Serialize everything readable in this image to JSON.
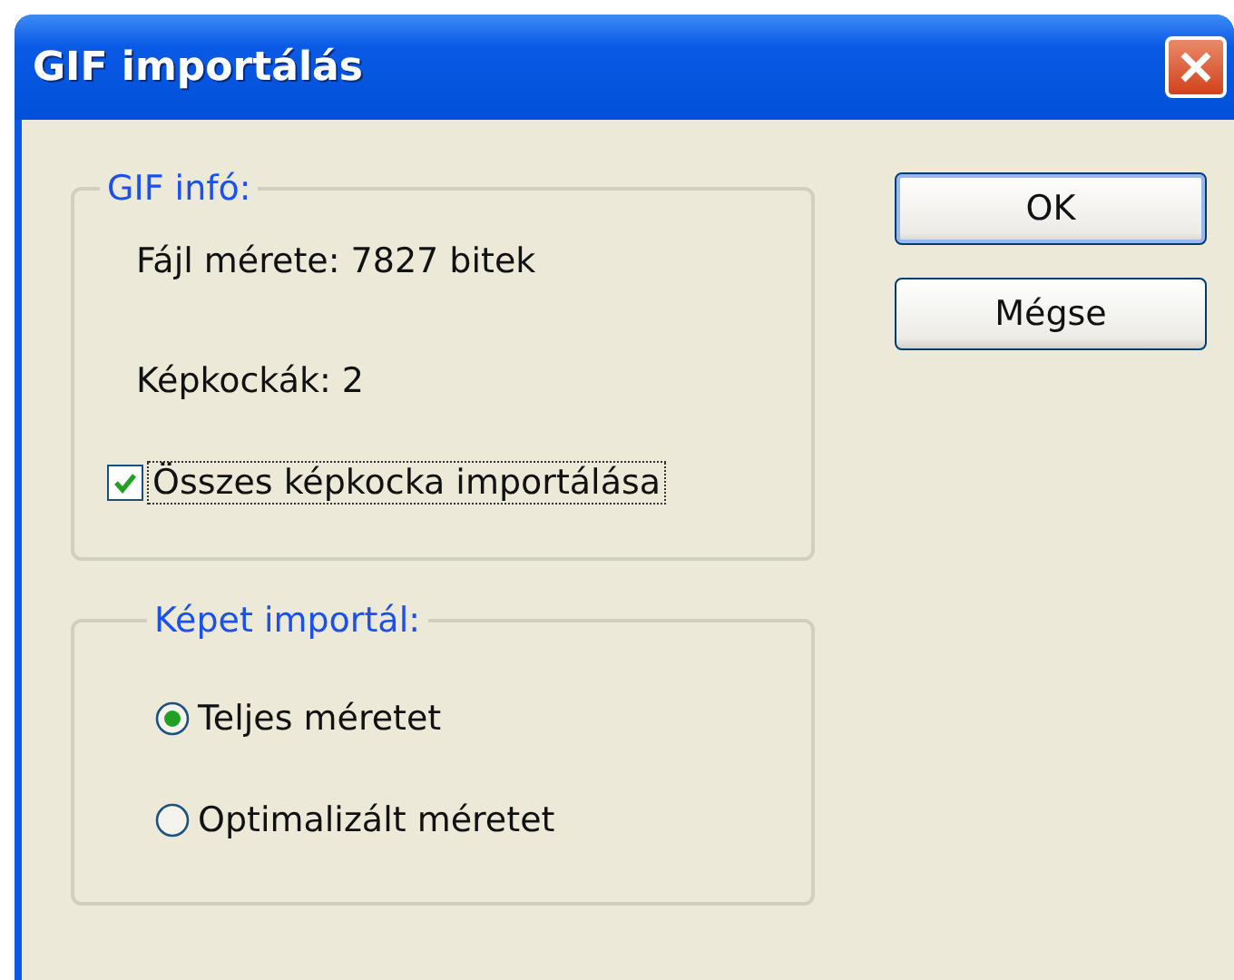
{
  "window": {
    "title": "GIF importálás"
  },
  "gif_info": {
    "title": "GIF infó:",
    "file_size": "Fájl mérete: 7827 bitek",
    "frames": "Képkockák: 2",
    "import_all": {
      "label": "Összes képkocka importálása",
      "checked": true
    }
  },
  "import_image": {
    "title": "Képet importál:",
    "options": [
      {
        "label": "Teljes méretet",
        "selected": true
      },
      {
        "label": "Optimalizált méretet",
        "selected": false
      }
    ]
  },
  "buttons": [
    "OK",
    "Mégse"
  ]
}
